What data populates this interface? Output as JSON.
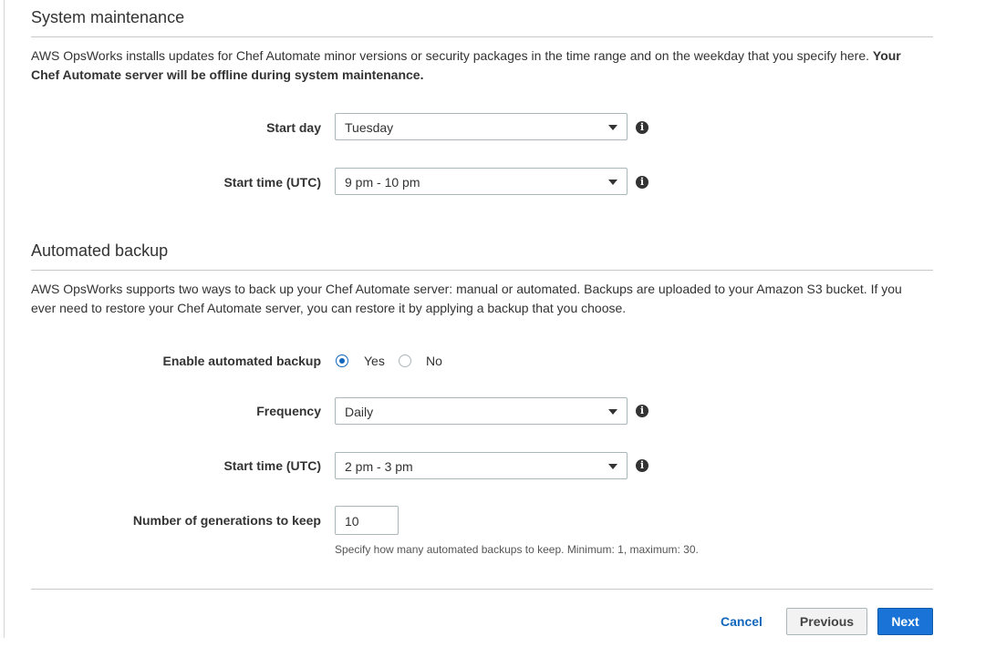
{
  "maintenance": {
    "title": "System maintenance",
    "desc_plain": "AWS OpsWorks installs updates for Chef Automate minor versions or security packages in the time range and on the weekday that you specify here. ",
    "desc_bold": "Your Chef Automate server will be offline during system maintenance.",
    "start_day_label": "Start day",
    "start_day_value": "Tuesday",
    "start_time_label": "Start time (UTC)",
    "start_time_value": "9 pm - 10 pm"
  },
  "backup": {
    "title": "Automated backup",
    "desc": "AWS OpsWorks supports two ways to back up your Chef Automate server: manual or automated. Backups are uploaded to your Amazon S3 bucket. If you ever need to restore your Chef Automate server, you can restore it by applying a backup that you choose.",
    "enable_label": "Enable automated backup",
    "yes_label": "Yes",
    "no_label": "No",
    "enabled": "Yes",
    "frequency_label": "Frequency",
    "frequency_value": "Daily",
    "start_time_label": "Start time (UTC)",
    "start_time_value": "2 pm - 3 pm",
    "generations_label": "Number of generations to keep",
    "generations_value": "10",
    "generations_hint": "Specify how many automated backups to keep. Minimum: 1, maximum: 30."
  },
  "footer": {
    "cancel_label": "Cancel",
    "previous_label": "Previous",
    "next_label": "Next"
  },
  "icons": {
    "info": "info-icon",
    "dropdown": "caret-down-icon"
  },
  "colors": {
    "primary": "#1a73d6",
    "link": "#1166bb"
  }
}
